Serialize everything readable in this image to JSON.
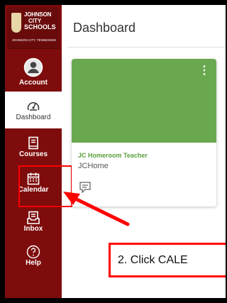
{
  "logo": {
    "line1": "JOHNSON",
    "line2": "CITY",
    "line3": "SCHOOLS",
    "line4": "JOHNSON CITY, TENNESSEE"
  },
  "nav": {
    "items": [
      {
        "label": "Account",
        "icon": "account-icon"
      },
      {
        "label": "Dashboard",
        "icon": "dashboard-icon"
      },
      {
        "label": "Courses",
        "icon": "courses-icon"
      },
      {
        "label": "Calendar",
        "icon": "calendar-icon"
      },
      {
        "label": "Inbox",
        "icon": "inbox-icon"
      },
      {
        "label": "Help",
        "icon": "help-icon"
      }
    ]
  },
  "page": {
    "title": "Dashboard"
  },
  "card": {
    "title": "JC Homeroom Teacher",
    "subtitle": "JCHome",
    "color": "#6aa84f"
  },
  "annotation": {
    "text": "2. Click CALE"
  },
  "colors": {
    "nav": "#7e0c0c",
    "highlight": "#ff0000",
    "accent": "#6aa84f"
  }
}
